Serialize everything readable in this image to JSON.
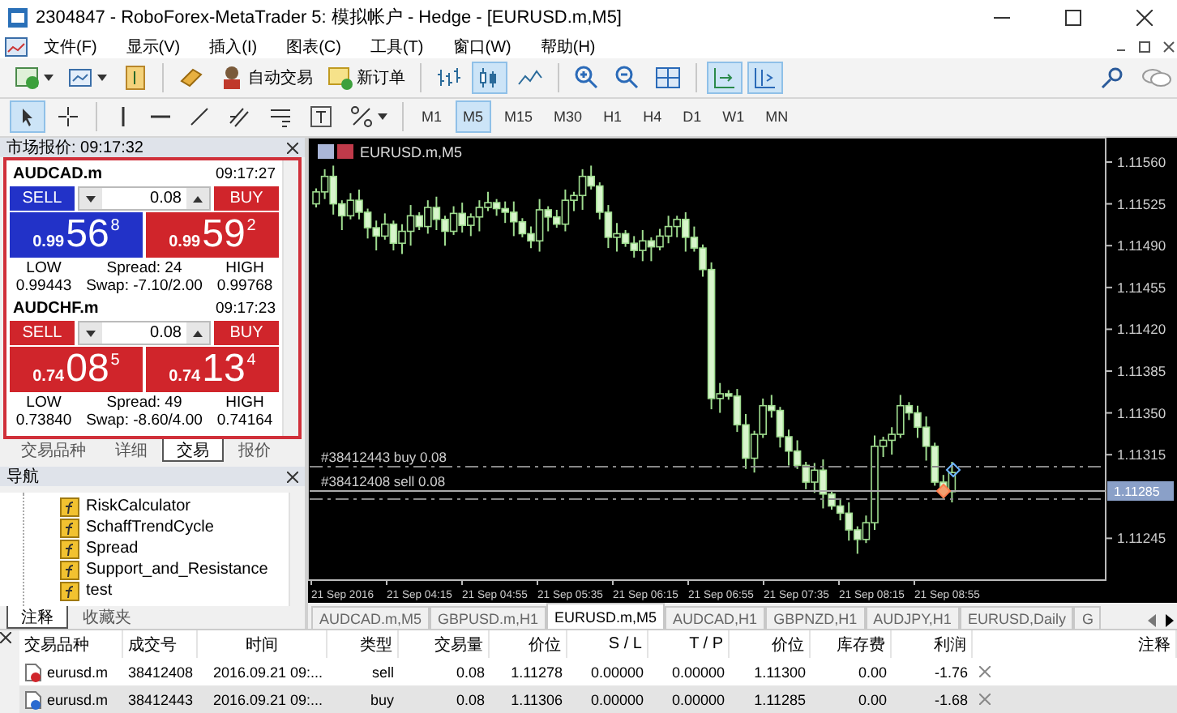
{
  "window": {
    "title": "2304847 - RoboForex-MetaTrader 5: 模拟帐户 - Hedge - [EURUSD.m,M5]"
  },
  "menu": [
    "文件(F)",
    "显示(V)",
    "插入(I)",
    "图表(C)",
    "工具(T)",
    "窗口(W)",
    "帮助(H)"
  ],
  "toolbar": {
    "algo_trading": "自动交易",
    "new_order": "新订单",
    "chart_types": [
      {
        "kind": "bars",
        "selected": false
      },
      {
        "kind": "candles",
        "selected": true
      },
      {
        "kind": "line",
        "selected": false
      }
    ],
    "auto_scroll": true,
    "chart_shift": true
  },
  "drawing_tools": [
    {
      "kind": "cursor",
      "selected": true
    },
    {
      "kind": "crosshair",
      "selected": false
    }
  ],
  "timeframes": [
    {
      "label": "M1",
      "selected": false
    },
    {
      "label": "M5",
      "selected": true
    },
    {
      "label": "M15",
      "selected": false
    },
    {
      "label": "M30",
      "selected": false
    },
    {
      "label": "H1",
      "selected": false
    },
    {
      "label": "H4",
      "selected": false
    },
    {
      "label": "D1",
      "selected": false
    },
    {
      "label": "W1",
      "selected": false
    },
    {
      "label": "MN",
      "selected": false
    }
  ],
  "market_watch": {
    "title": "市场报价: 09:17:32",
    "symbols": [
      {
        "name": "AUDCAD.m",
        "time": "09:17:27",
        "sell_label": "SELL",
        "buy_label": "BUY",
        "volume": "0.08",
        "bid": {
          "big": "0.99",
          "pips": "56",
          "point": "8",
          "color": "#2232c8"
        },
        "ask": {
          "big": "0.99",
          "pips": "59",
          "point": "2",
          "color": "#d0252b"
        },
        "low_label": "LOW",
        "low": "0.99443",
        "spread": "Spread: 24",
        "swap": "Swap: -7.10/2.00",
        "high_label": "HIGH",
        "high": "0.99768"
      },
      {
        "name": "AUDCHF.m",
        "time": "09:17:23",
        "sell_label": "SELL",
        "buy_label": "BUY",
        "volume": "0.08",
        "bid": {
          "big": "0.74",
          "pips": "08",
          "point": "5",
          "color": "#d0252b"
        },
        "ask": {
          "big": "0.74",
          "pips": "13",
          "point": "4",
          "color": "#d0252b"
        },
        "low_label": "LOW",
        "low": "0.73840",
        "spread": "Spread: 49",
        "swap": "Swap: -8.60/4.00",
        "high_label": "HIGH",
        "high": "0.74164"
      }
    ],
    "tabs": [
      {
        "label": "交易品种",
        "selected": false
      },
      {
        "label": "详细",
        "selected": false
      },
      {
        "label": "交易",
        "selected": true
      },
      {
        "label": "报价",
        "selected": false
      }
    ]
  },
  "navigator": {
    "title": "导航",
    "items": [
      "RiskCalculator",
      "SchaffTrendCycle",
      "Spread",
      "Support_and_Resistance",
      "test"
    ],
    "tabs": [
      {
        "label": "注释",
        "selected": true
      },
      {
        "label": "收藏夹",
        "selected": false
      }
    ]
  },
  "chart": {
    "title": "EURUSD.m,M5",
    "price_labels": [
      "1.11560",
      "1.11525",
      "1.11490",
      "1.11455",
      "1.11420",
      "1.11385",
      "1.11350",
      "1.11315",
      "1.11245"
    ],
    "current_price": "1.11285",
    "time_labels": [
      "21 Sep 2016",
      "21 Sep 04:15",
      "21 Sep 04:55",
      "21 Sep 05:35",
      "21 Sep 06:15",
      "21 Sep 06:55",
      "21 Sep 07:35",
      "21 Sep 08:15",
      "21 Sep 08:55"
    ],
    "orders": [
      {
        "label": "#38412443 buy 0.08",
        "kind": "buy"
      },
      {
        "label": "#38412408 sell 0.08",
        "kind": "sell"
      }
    ]
  },
  "chart_tabs": [
    {
      "label": "AUDCAD.m,M5",
      "selected": false
    },
    {
      "label": "GBPUSD.m,H1",
      "selected": false
    },
    {
      "label": "EURUSD.m,M5",
      "selected": true
    },
    {
      "label": "AUDCAD,H1",
      "selected": false
    },
    {
      "label": "GBPNZD,H1",
      "selected": false
    },
    {
      "label": "AUDJPY,H1",
      "selected": false
    },
    {
      "label": "EURUSD,Daily",
      "selected": false
    },
    {
      "label": "G",
      "selected": false
    }
  ],
  "trade_table": {
    "columns": [
      "交易品种",
      "成交号",
      "时间",
      "类型",
      "交易量",
      "价位",
      "S / L",
      "T / P",
      "价位",
      "库存费",
      "利润",
      "注释"
    ],
    "rows": [
      {
        "symbol": "eurusd.m",
        "deal": "38412408",
        "time": "2016.09.21 09:...",
        "type": "sell",
        "volume": "0.08",
        "price": "1.11278",
        "sl": "0.00000",
        "tp": "0.00000",
        "current": "1.11300",
        "swap": "0.00",
        "profit": "-1.76",
        "kind": "sell",
        "selected": false
      },
      {
        "symbol": "eurusd.m",
        "deal": "38412443",
        "time": "2016.09.21 09:...",
        "type": "buy",
        "volume": "0.08",
        "price": "1.11306",
        "sl": "0.00000",
        "tp": "0.00000",
        "current": "1.11285",
        "swap": "0.00",
        "profit": "-1.68",
        "kind": "buy",
        "selected": true
      }
    ]
  }
}
